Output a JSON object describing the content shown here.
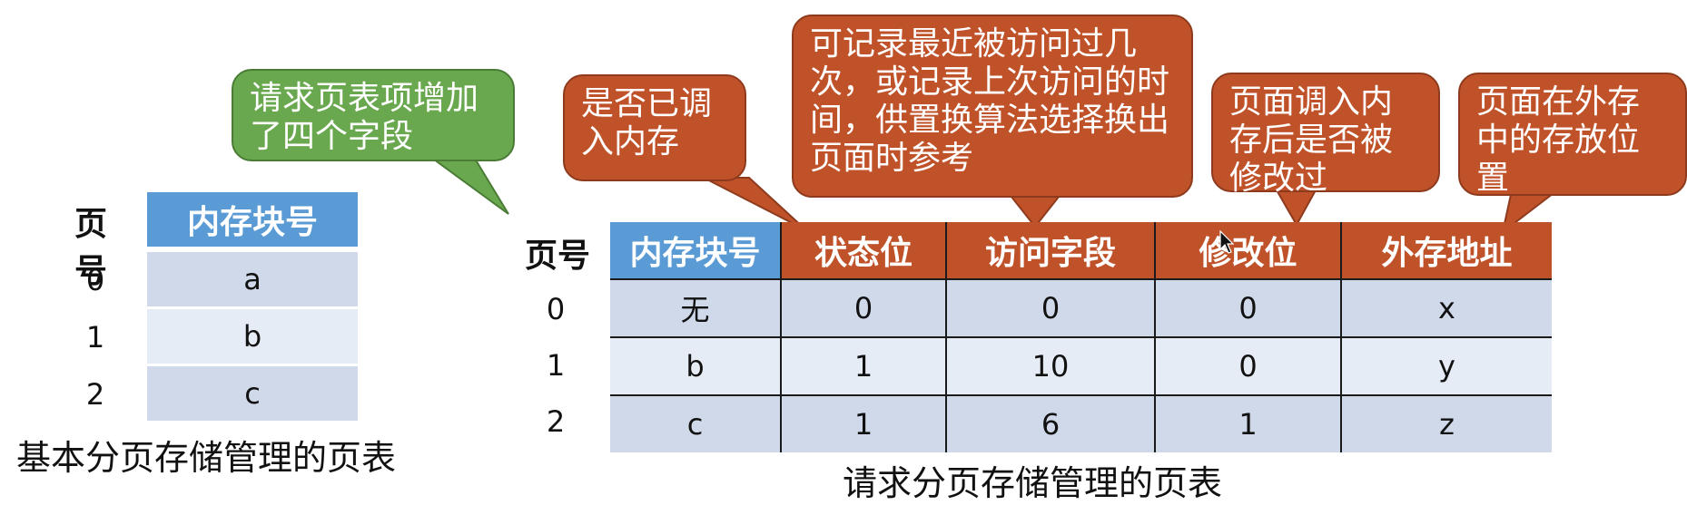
{
  "basic_table": {
    "header_page": "页号",
    "header_frame": "内存块号",
    "rows": [
      {
        "page": "0",
        "frame": "a"
      },
      {
        "page": "1",
        "frame": "b"
      },
      {
        "page": "2",
        "frame": "c"
      }
    ],
    "caption": "基本分页存储管理的页表"
  },
  "request_table": {
    "header_page": "页号",
    "headers": [
      "内存块号",
      "状态位",
      "访问字段",
      "修改位",
      "外存地址"
    ],
    "rows": [
      {
        "page": "0",
        "cells": [
          "无",
          "0",
          "0",
          "0",
          "x"
        ]
      },
      {
        "page": "1",
        "cells": [
          "b",
          "1",
          "10",
          "0",
          "y"
        ]
      },
      {
        "page": "2",
        "cells": [
          "c",
          "1",
          "6",
          "1",
          "z"
        ]
      }
    ],
    "caption": "请求分页存储管理的页表"
  },
  "callouts": {
    "added_fields": "请求页表项增加了四个字段",
    "status_bit": "是否已调入内存",
    "access_field": "可记录最近被访问过几次，或记录上次访问的时间，供置换算法选择换出页面时参考",
    "modify_bit": "页面调入内存后是否被修改过",
    "external_address": "页面在外存中的存放位置"
  },
  "colors": {
    "header_blue": "#5b9bd5",
    "header_orange": "#c0522a",
    "callout_green": "#6aa84f",
    "row_dark": "#cfd9ea",
    "row_light": "#e6ecf5"
  }
}
